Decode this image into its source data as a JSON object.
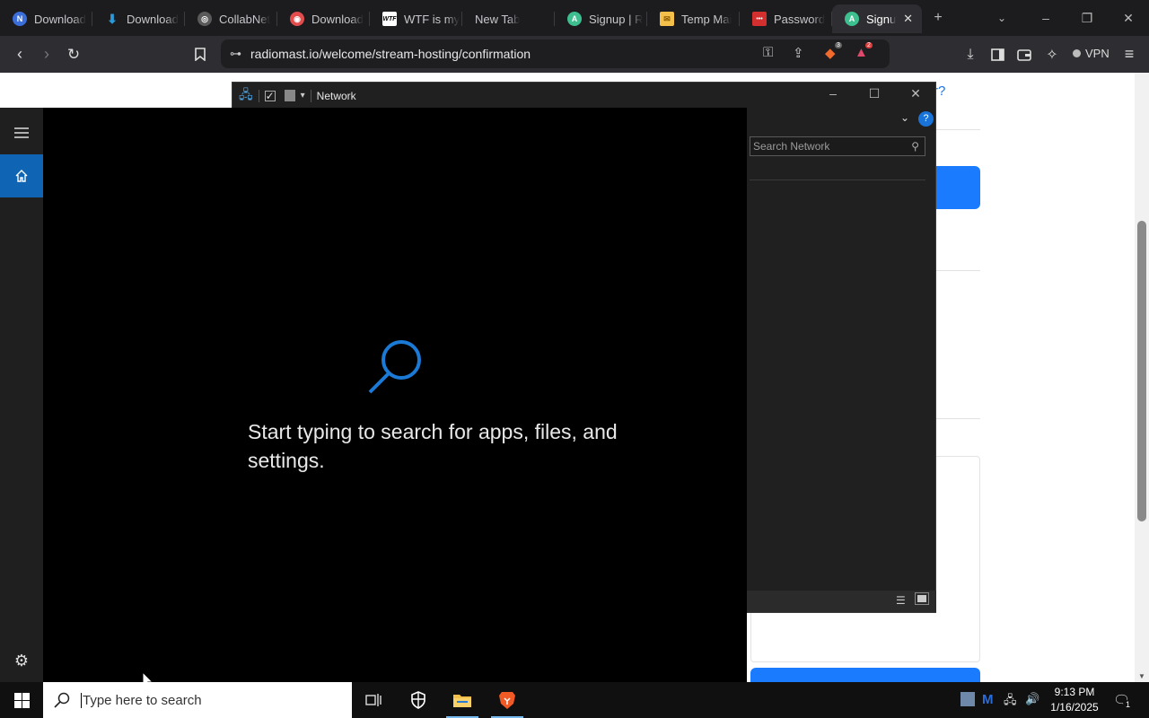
{
  "browser": {
    "tabs": [
      {
        "label": "Download",
        "favicon_color": "#3b6ed8",
        "favicon_glyph": "N"
      },
      {
        "label": "Download",
        "favicon_color": "#2a9bd8",
        "favicon_glyph": "↓"
      },
      {
        "label": "CollabNet",
        "favicon_color": "#5a5a5a",
        "favicon_glyph": "◎"
      },
      {
        "label": "Download",
        "favicon_color": "#e24c4c",
        "favicon_glyph": "◉"
      },
      {
        "label": "WTF is my",
        "favicon_color": "#ffffff",
        "favicon_glyph": "WTF"
      },
      {
        "label": "New Tab",
        "favicon_color": "",
        "favicon_glyph": ""
      },
      {
        "label": "Signup | R",
        "favicon_color": "#3dbf8f",
        "favicon_glyph": "A"
      },
      {
        "label": "Temp Mai",
        "favicon_color": "#f4c04a",
        "favicon_glyph": "✉"
      },
      {
        "label": "Password",
        "favicon_color": "#d42f2f",
        "favicon_glyph": "•••"
      },
      {
        "label": "Signu",
        "favicon_color": "#3dbf8f",
        "favicon_glyph": "A",
        "active": true
      }
    ],
    "url": "radiomast.io/welcome/stream-hosting/confirmation",
    "shield_count": "3",
    "alert_count": "2",
    "vpn_label": "VPN"
  },
  "webpage": {
    "partial_link": "r?"
  },
  "network_window": {
    "title": "Network",
    "search_placeholder": "Search Network"
  },
  "start_panel": {
    "hint_text": "Start typing to search for apps, files, and settings.",
    "accent": "#1064b4"
  },
  "taskbar": {
    "search_placeholder": "Type here to search",
    "time": "9:13 PM",
    "date": "1/16/2025",
    "notification_count": "1"
  }
}
